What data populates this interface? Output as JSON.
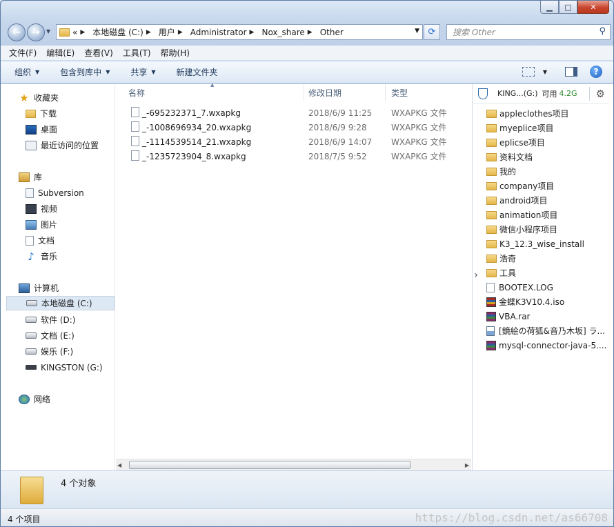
{
  "address": {
    "overflow": "«",
    "crumbs": [
      "本地磁盘 (C:)",
      "用户",
      "Administrator",
      "Nox_share",
      "Other"
    ]
  },
  "search": {
    "placeholder": "搜索 Other"
  },
  "menu": [
    "文件(F)",
    "编辑(E)",
    "查看(V)",
    "工具(T)",
    "帮助(H)"
  ],
  "commands": {
    "organize": "组织",
    "include_in_library": "包含到库中",
    "share": "共享",
    "new_folder": "新建文件夹"
  },
  "nav": {
    "favorites": "收藏夹",
    "downloads": "下载",
    "desktop": "桌面",
    "recent": "最近访问的位置",
    "libraries": "库",
    "subversion": "Subversion",
    "videos": "视频",
    "pictures": "图片",
    "documents": "文档",
    "music": "音乐",
    "computer": "计算机",
    "drive_c": "本地磁盘 (C:)",
    "drive_d": "软件 (D:)",
    "drive_e": "文档 (E:)",
    "drive_f": "娱乐 (F:)",
    "drive_g": "KINGSTON (G:)",
    "network": "网络"
  },
  "columns": {
    "name": "名称",
    "date": "修改日期",
    "type": "类型"
  },
  "files": [
    {
      "name": "_-695232371_7.wxapkg",
      "date": "2018/6/9 11:25",
      "type": "WXAPKG 文件"
    },
    {
      "name": "_-1008696934_20.wxapkg",
      "date": "2018/6/9 9:28",
      "type": "WXAPKG 文件"
    },
    {
      "name": "_-1114539514_21.wxapkg",
      "date": "2018/6/9 14:07",
      "type": "WXAPKG 文件"
    },
    {
      "name": "_-1235723904_8.wxapkg",
      "date": "2018/7/5 9:52",
      "type": "WXAPKG 文件"
    }
  ],
  "preview": {
    "drive_label": "KING...(G:)",
    "available_label": "可用",
    "free_size": "4.2G",
    "items": [
      {
        "name": "appleclothes项目",
        "kind": "folder"
      },
      {
        "name": "myeplice项目",
        "kind": "folder"
      },
      {
        "name": "eplicse项目",
        "kind": "folder"
      },
      {
        "name": "资料文档",
        "kind": "folder"
      },
      {
        "name": "我的",
        "kind": "folder"
      },
      {
        "name": "company项目",
        "kind": "folder"
      },
      {
        "name": "android项目",
        "kind": "folder"
      },
      {
        "name": "animation项目",
        "kind": "folder"
      },
      {
        "name": "微信小程序项目",
        "kind": "folder"
      },
      {
        "name": "K3_12.3_wise_install",
        "kind": "folder"
      },
      {
        "name": "浩奇",
        "kind": "folder"
      },
      {
        "name": "工具",
        "kind": "folder"
      },
      {
        "name": "BOOTEX.LOG",
        "kind": "file"
      },
      {
        "name": "金蝶K3V10.4.iso",
        "kind": "iso"
      },
      {
        "name": "VBA.rar",
        "kind": "rar"
      },
      {
        "name": "[鏡絵の荷狐&音乃木坂] ラ...",
        "kind": "image"
      },
      {
        "name": "mysql-connector-java-5....",
        "kind": "rar"
      }
    ]
  },
  "details": {
    "object_count": "4 个对象"
  },
  "status": {
    "item_count": "4 个项目",
    "watermark": "https://blog.csdn.net/as66708"
  },
  "colors": {
    "selection": "#dde8f5",
    "accent": "#2a6fcf",
    "close": "#c8452e"
  }
}
